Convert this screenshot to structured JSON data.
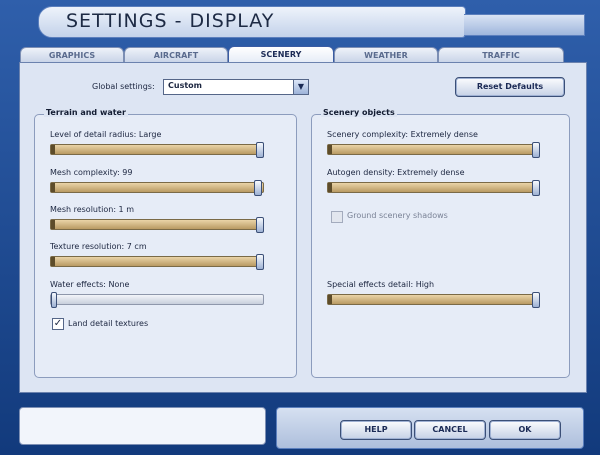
{
  "window": {
    "title": "SETTINGS - DISPLAY"
  },
  "tabs": [
    {
      "label": "GRAPHICS",
      "active": false
    },
    {
      "label": "AIRCRAFT",
      "active": false
    },
    {
      "label": "SCENERY",
      "active": true
    },
    {
      "label": "WEATHER",
      "active": false
    },
    {
      "label": "TRAFFIC",
      "active": false
    }
  ],
  "global_settings": {
    "label": "Global settings:",
    "value": "Custom"
  },
  "reset_defaults_label": "Reset Defaults",
  "terrain_water": {
    "title": "Terrain and water",
    "level_of_detail": {
      "label": "Level of detail radius: Large",
      "level": 1.0
    },
    "mesh_complexity": {
      "label": "Mesh complexity: 99",
      "level": 0.99
    },
    "mesh_resolution": {
      "label": "Mesh resolution: 1 m",
      "level": 1.0
    },
    "texture_resolution": {
      "label": "Texture resolution: 7 cm",
      "level": 1.0
    },
    "water_effects": {
      "label": "Water effects: None",
      "level": 0.0
    },
    "land_detail_textures": {
      "label": "Land detail textures",
      "checked": true
    }
  },
  "scenery_objects": {
    "title": "Scenery objects",
    "scenery_complexity": {
      "label": "Scenery complexity: Extremely dense",
      "level": 1.0
    },
    "autogen_density": {
      "label": "Autogen density: Extremely dense",
      "level": 1.0
    },
    "ground_scenery_shadows": {
      "label": "Ground scenery shadows",
      "checked": false,
      "enabled": false
    },
    "special_effects": {
      "label": "Special effects detail: High",
      "level": 1.0
    }
  },
  "buttons": {
    "help": "HELP",
    "cancel": "CANCEL",
    "ok": "OK"
  },
  "icons": {
    "dropdown": "chevron-down-icon",
    "check": "checkmark-icon"
  },
  "colors": {
    "frame_blue": "#1a3d7a",
    "slider_fill": "#c9ab70",
    "panel_bg": "#dde5f3"
  }
}
